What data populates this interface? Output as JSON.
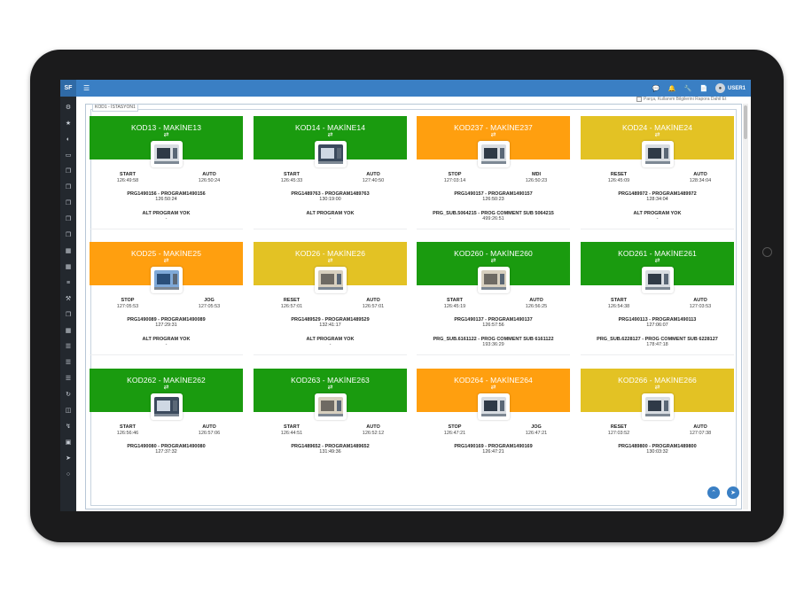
{
  "app": {
    "brand": "SF",
    "menu_icon": "hamburger-icon",
    "user": "USER1",
    "topbar_icons": [
      "chat-icon",
      "bell-icon",
      "wrench-icon",
      "document-icon"
    ]
  },
  "sidebar": {
    "icons": [
      "logo-icon",
      "star-icon",
      "dashboard-icon",
      "monitor-icon",
      "copy-icon",
      "copy-icon",
      "copy-icon",
      "copy-icon",
      "copy-icon",
      "calendar-icon",
      "calendar-icon",
      "filter-icon",
      "wrench-icon",
      "copy-icon",
      "calendar-icon",
      "list-icon",
      "list-icon",
      "list-icon",
      "refresh-icon",
      "database-icon",
      "bolt-icon",
      "box-icon",
      "send-icon",
      "comment-icon"
    ]
  },
  "station": {
    "legend": "KOD1 - İSTASYON1",
    "report_label": "Parça, Kullanım Bilgilerini Rapora Dahil Et"
  },
  "colors": {
    "green": "#1a9b0f",
    "orange": "#ff9f0f",
    "yellow": "#e3c224"
  },
  "machines": [
    {
      "title": "KOD13 - MAKİNE13",
      "color": "green",
      "pic": "light",
      "left_label": "START",
      "left_time": "126:49:58",
      "right_label": "AUTO",
      "right_time": "126:50:24",
      "program": "PRG1490156 - PROGRAM1490156",
      "program_time": "126:50:24",
      "sub": "ALT PROGRAM YOK",
      "sub_time": "-"
    },
    {
      "title": "KOD14 - MAKİNE14",
      "color": "green",
      "pic": "dark",
      "left_label": "START",
      "left_time": "126:45:33",
      "right_label": "AUTO",
      "right_time": "127:40:50",
      "program": "PRG1489763 - PROGRAM1489763",
      "program_time": "130:19:00",
      "sub": "ALT PROGRAM YOK",
      "sub_time": "-"
    },
    {
      "title": "KOD237 - MAKİNE237",
      "color": "orange",
      "pic": "light",
      "left_label": "STOP",
      "left_time": "127:03:14",
      "right_label": "MDI",
      "right_time": "126:50:23",
      "program": "PRG1490157 - PROGRAM1490157",
      "program_time": "126:50:23",
      "sub": "PRG_SUB.5064215 - PROG COMMENT SUB 5064215",
      "sub_time": "499:26:51"
    },
    {
      "title": "KOD24 - MAKİNE24",
      "color": "yellow",
      "pic": "light",
      "left_label": "RESET",
      "left_time": "126:45:09",
      "right_label": "AUTO",
      "right_time": "128:34:04",
      "program": "PRG1489972 - PROGRAM1489972",
      "program_time": "128:34:04",
      "sub": "ALT PROGRAM YOK",
      "sub_time": "-"
    },
    {
      "title": "KOD25 - MAKİNE25",
      "color": "orange",
      "pic": "blue",
      "left_label": "STOP",
      "left_time": "127:05:53",
      "right_label": "JOG",
      "right_time": "127:05:53",
      "program": "PRG1490089 - PROGRAM1490089",
      "program_time": "127:29:31",
      "sub": "ALT PROGRAM YOK",
      "sub_time": "-"
    },
    {
      "title": "KOD26 - MAKİNE26",
      "color": "yellow",
      "pic": "beige",
      "left_label": "RESET",
      "left_time": "126:57:01",
      "right_label": "AUTO",
      "right_time": "126:57:01",
      "program": "PRG1489529 - PROGRAM1489529",
      "program_time": "132:41:17",
      "sub": "ALT PROGRAM YOK",
      "sub_time": "-"
    },
    {
      "title": "KOD260 - MAKİNE260",
      "color": "green",
      "pic": "beige",
      "left_label": "START",
      "left_time": "126:45:19",
      "right_label": "AUTO",
      "right_time": "126:56:25",
      "program": "PRG1490137 - PROGRAM1490137",
      "program_time": "126:57:56",
      "sub": "PRG_SUB.6161122 - PROG COMMENT SUB 6161122",
      "sub_time": "193:36:29"
    },
    {
      "title": "KOD261 - MAKİNE261",
      "color": "green",
      "pic": "light",
      "left_label": "START",
      "left_time": "126:54:38",
      "right_label": "AUTO",
      "right_time": "127:03:53",
      "program": "PRG1490113 - PROGRAM1490113",
      "program_time": "127:06:07",
      "sub": "PRG_SUB.6228127 - PROG COMMENT SUB 6228127",
      "sub_time": "178:47:18"
    },
    {
      "title": "KOD262 - MAKİNE262",
      "color": "green",
      "pic": "dark",
      "left_label": "START",
      "left_time": "126:56:46",
      "right_label": "AUTO",
      "right_time": "126:57:06",
      "program": "PRG1490080 - PROGRAM1490080",
      "program_time": "127:37:32",
      "sub": "",
      "sub_time": ""
    },
    {
      "title": "KOD263 - MAKİNE263",
      "color": "green",
      "pic": "beige",
      "left_label": "START",
      "left_time": "126:44:51",
      "right_label": "AUTO",
      "right_time": "126:52:12",
      "program": "PRG1489652 - PROGRAM1489652",
      "program_time": "131:49:36",
      "sub": "",
      "sub_time": ""
    },
    {
      "title": "KOD264 - MAKİNE264",
      "color": "orange",
      "pic": "light",
      "left_label": "STOP",
      "left_time": "126:47:21",
      "right_label": "JOG",
      "right_time": "126:47:21",
      "program": "PRG1490169 - PROGRAM1490169",
      "program_time": "126:47:21",
      "sub": "",
      "sub_time": ""
    },
    {
      "title": "KOD266 - MAKİNE266",
      "color": "yellow",
      "pic": "light",
      "left_label": "RESET",
      "left_time": "127:03:52",
      "right_label": "AUTO",
      "right_time": "127:07:38",
      "program": "PRG1489800 - PROGRAM1489800",
      "program_time": "130:03:32",
      "sub": "",
      "sub_time": ""
    }
  ],
  "status_icon": "swap-arrows-icon",
  "fabs": {
    "scroll_top_icon": "double-chevron-up-icon",
    "send_icon": "send-icon"
  }
}
